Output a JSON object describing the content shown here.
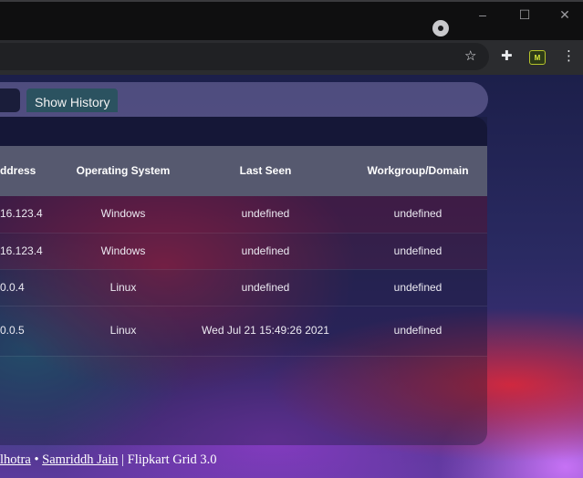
{
  "window": {
    "minimize_glyph": "–",
    "maximize_glyph": "☐",
    "close_glyph": "✕"
  },
  "toolbar": {
    "bookmark_glyph": "☆",
    "extensions_glyph": "✚",
    "menu_glyph": "⋮",
    "extension_badge": "M"
  },
  "history_button": "Show History",
  "table": {
    "headers": [
      "ddress",
      "Operating System",
      "Last Seen",
      "Workgroup/Domain"
    ],
    "rows": [
      {
        "address": "16.123.4",
        "os": "Windows",
        "last_seen": "undefined",
        "workgroup": "undefined"
      },
      {
        "address": "16.123.4",
        "os": "Windows",
        "last_seen": "undefined",
        "workgroup": "undefined"
      },
      {
        "address": "0.0.4",
        "os": "Linux",
        "last_seen": "undefined",
        "workgroup": "undefined"
      },
      {
        "address": "0.0.5",
        "os": "Linux",
        "last_seen": "Wed Jul 21 15:49:26 2021",
        "workgroup": "undefined"
      }
    ]
  },
  "footer": {
    "author1": "lhotra",
    "separator": " • ",
    "author2": "Samriddh Jain",
    "suffix": " | Flipkart Grid 3.0"
  }
}
